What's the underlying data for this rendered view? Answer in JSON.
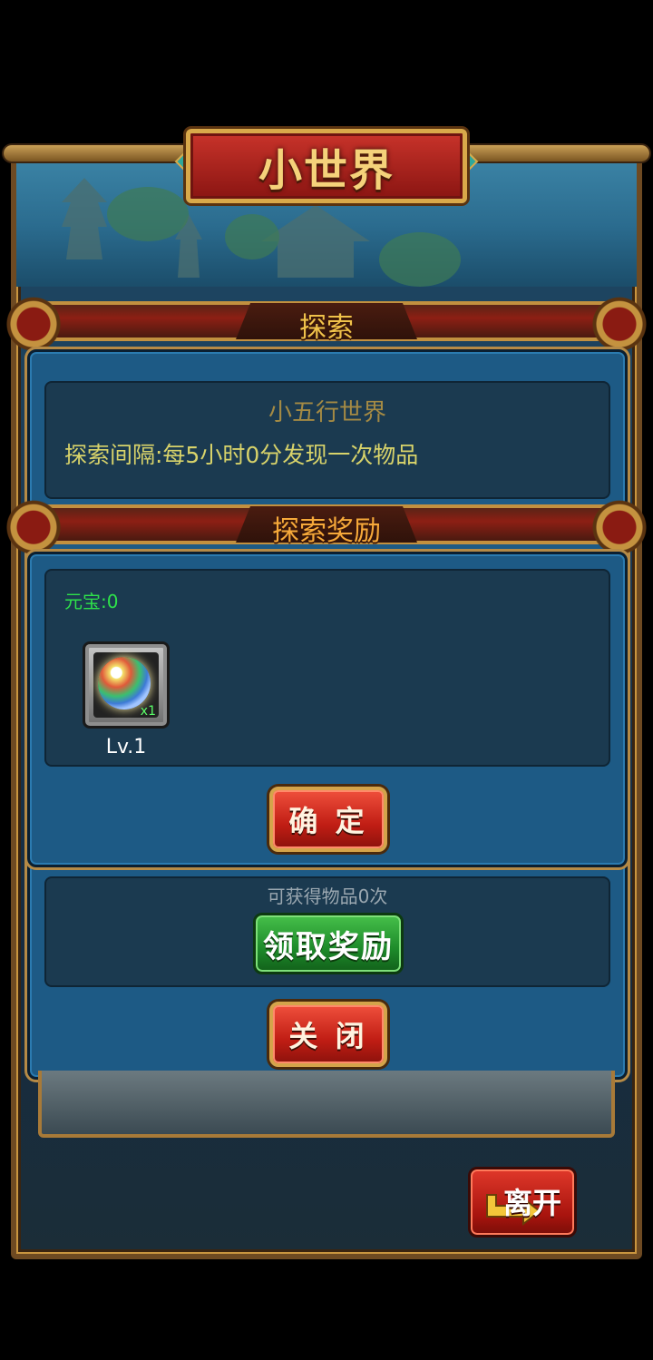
{
  "title": "小世界",
  "explore": {
    "header": "探索",
    "world_name": "小五行世界",
    "interval_text": "探索间隔:每5小时0分发现一次物品",
    "obtainable_text": "可获得物品0次",
    "claim_button": "领取奖励",
    "close_button": "关 闭"
  },
  "reward": {
    "header": "探索奖励",
    "currency_text": "元宝:0",
    "item": {
      "icon": "orb-icon",
      "quantity": "x1",
      "level": "Lv.1"
    },
    "confirm_button": "确 定"
  },
  "leave_button": "离开",
  "colors": {
    "accent_gold": "#f0c24a",
    "panel_blue": "#1d5a85",
    "button_red": "#c01d14",
    "button_green": "#1d8a2a",
    "currency_green": "#2ee14a"
  }
}
